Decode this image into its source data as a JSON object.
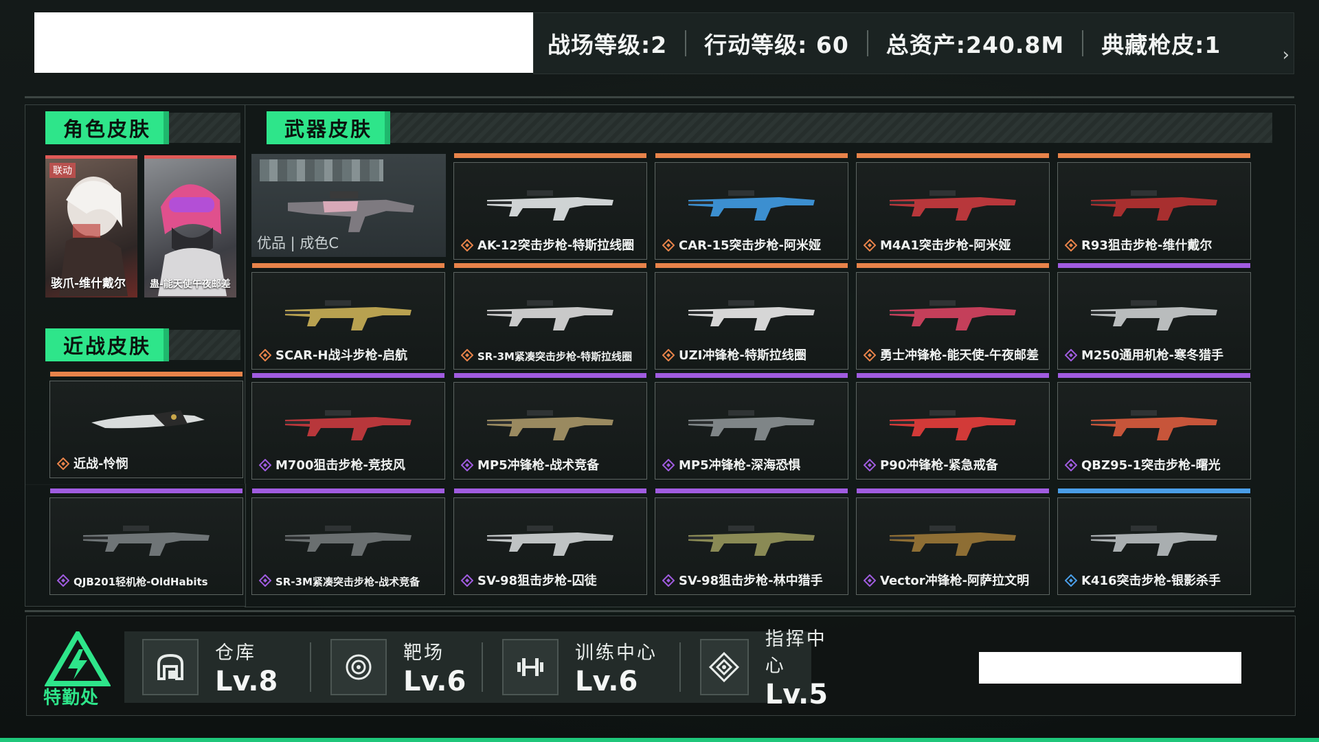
{
  "header": {
    "stats": [
      {
        "label": "战场等级:2"
      },
      {
        "label": "行动等级: 60"
      },
      {
        "label": "总资产:240.8M"
      },
      {
        "label": "典藏枪皮:1"
      }
    ]
  },
  "sections": {
    "character": "角色皮肤",
    "melee": "近战皮肤",
    "weapon": "武器皮肤"
  },
  "character_skins": [
    {
      "badge": "联动",
      "name": "骇爪-维什戴尔"
    },
    {
      "name": "蛊-能天使午夜邮差"
    }
  ],
  "melee_skins": [
    {
      "name": "近战-怜悯"
    }
  ],
  "featured": {
    "grade": "优品 | 成色C"
  },
  "weapon_skins": [
    {
      "name": "AK-12突击步枪-特斯拉线圈",
      "rarity": "orange"
    },
    {
      "name": "CAR-15突击步枪-阿米娅",
      "rarity": "orange"
    },
    {
      "name": "M4A1突击步枪-阿米娅",
      "rarity": "orange"
    },
    {
      "name": "R93狙击步枪-维什戴尔",
      "rarity": "orange"
    },
    {
      "name": "SCAR-H战斗步枪-启航",
      "rarity": "orange"
    },
    {
      "name": "SR-3M紧凑突击步枪-特斯拉线圈",
      "rarity": "orange"
    },
    {
      "name": "UZI冲锋枪-特斯拉线圈",
      "rarity": "orange"
    },
    {
      "name": "勇士冲锋枪-能天使-午夜邮差",
      "rarity": "orange"
    },
    {
      "name": "M250通用机枪-寒冬猎手",
      "rarity": "purple"
    },
    {
      "name": "M700狙击步枪-竞技风",
      "rarity": "purple"
    },
    {
      "name": "MP5冲锋枪-战术竞备",
      "rarity": "purple"
    },
    {
      "name": "MP5冲锋枪-深海恐惧",
      "rarity": "purple"
    },
    {
      "name": "P90冲锋枪-紧急戒备",
      "rarity": "purple"
    },
    {
      "name": "QBZ95-1突击步枪-曙光",
      "rarity": "purple"
    },
    {
      "name": "QJB201轻机枪-OldHabits",
      "rarity": "purple"
    },
    {
      "name": "SR-3M紧凑突击步枪-战术竞备",
      "rarity": "purple"
    },
    {
      "name": "SV-98狙击步枪-囚徒",
      "rarity": "purple"
    },
    {
      "name": "SV-98狙击步枪-林中猎手",
      "rarity": "purple"
    },
    {
      "name": "Vector冲锋枪-阿萨拉文明",
      "rarity": "purple"
    },
    {
      "name": "K416突击步枪-银影杀手",
      "rarity": "blue"
    }
  ],
  "colors": {
    "orange": "#e8834a",
    "purple": "#a05ce0",
    "blue": "#4a9ee8",
    "accent": "#2ee58a"
  },
  "bottom": {
    "hq_label": "特勤处",
    "facilities": [
      {
        "name": "仓库",
        "level": "Lv.8",
        "icon": "warehouse-icon"
      },
      {
        "name": "靶场",
        "level": "Lv.6",
        "icon": "target-icon"
      },
      {
        "name": "训练中心",
        "level": "Lv.6",
        "icon": "dumbbell-icon"
      },
      {
        "name": "指挥中心",
        "level": "Lv.5",
        "icon": "command-icon"
      }
    ]
  }
}
